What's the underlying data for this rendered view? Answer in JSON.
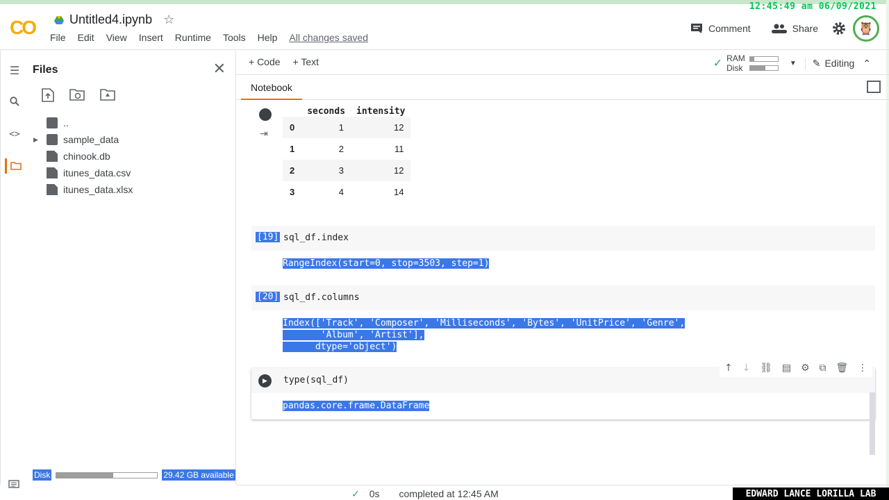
{
  "overlay_clock": "12:45:49 am 06/09/2021",
  "notebook": {
    "title": "Untitled4.ipynb"
  },
  "menu": [
    "File",
    "Edit",
    "View",
    "Insert",
    "Runtime",
    "Tools",
    "Help"
  ],
  "save_status": "All changes saved",
  "header_actions": {
    "comment": "Comment",
    "share": "Share"
  },
  "toolbar": {
    "code": "+ Code",
    "text": "+ Text",
    "ram": "RAM",
    "disk": "Disk",
    "editing": "Editing",
    "ram_usage": 0.15,
    "disk_usage": 0.55
  },
  "tab": "Notebook",
  "files": {
    "title": "Files",
    "tree": [
      {
        "name": "..",
        "type": "up"
      },
      {
        "name": "sample_data",
        "type": "folder"
      },
      {
        "name": "chinook.db",
        "type": "file"
      },
      {
        "name": "itunes_data.csv",
        "type": "file"
      },
      {
        "name": "itunes_data.xlsx",
        "type": "file"
      }
    ],
    "disk_label": "Disk",
    "disk_available": "29.42 GB available",
    "disk_usage": 0.56
  },
  "dataframe": {
    "columns": [
      "seconds",
      "intensity"
    ],
    "rows": [
      {
        "idx": "0",
        "seconds": "1",
        "intensity": "12"
      },
      {
        "idx": "1",
        "seconds": "2",
        "intensity": "11"
      },
      {
        "idx": "2",
        "seconds": "3",
        "intensity": "12"
      },
      {
        "idx": "3",
        "seconds": "4",
        "intensity": "14"
      }
    ]
  },
  "cells": [
    {
      "count": "[19]",
      "code": "sql_df.index",
      "output": "RangeIndex(start=0, stop=3503, step=1)"
    },
    {
      "count": "[20]",
      "code": "sql_df.columns",
      "output": "Index(['Track', 'Composer', 'Milliseconds', 'Bytes', 'UnitPrice', 'Genre',\n       'Album', 'Artist'],\n      dtype='object')"
    },
    {
      "count": "",
      "code": "type(sql_df)",
      "output": "pandas.core.frame.DataFrame"
    }
  ],
  "footer": {
    "time": "0s",
    "status": "completed at 12:45 AM"
  },
  "lab_tag": "EDWARD LANCE LORILLA LAB"
}
